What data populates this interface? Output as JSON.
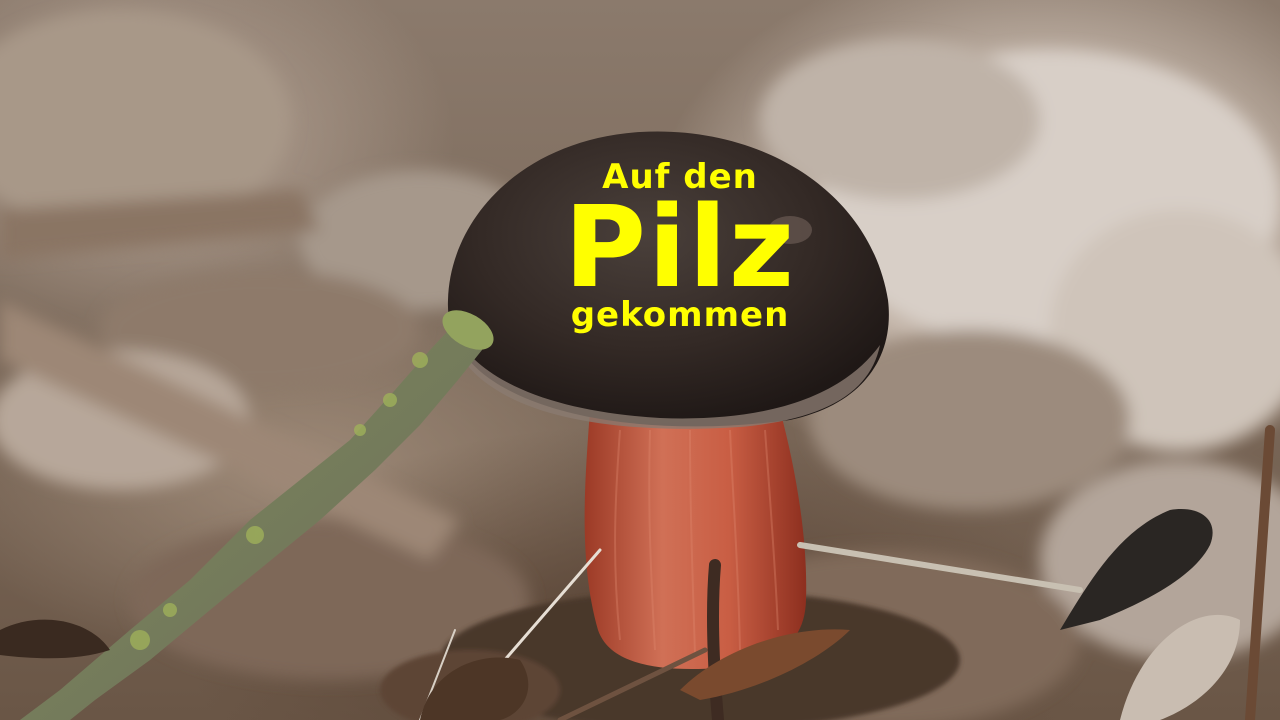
{
  "image": {
    "description_label": "mushroom-photo"
  },
  "title": {
    "line1": "Auf den",
    "line2": "Pilz",
    "line3": "gekommen",
    "color": "#ffff00"
  }
}
